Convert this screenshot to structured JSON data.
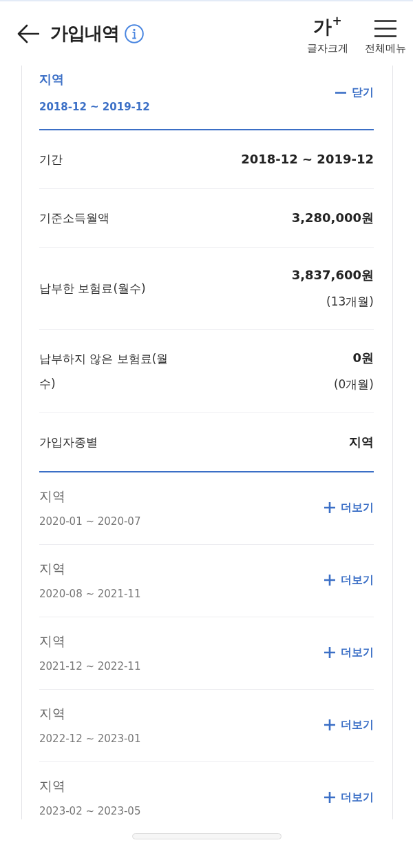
{
  "header": {
    "title": "가입내역",
    "font_size_button": {
      "glyph": "가$^{+}$",
      "label": "글자크게"
    },
    "menu_button": {
      "label": "전체메뉴"
    }
  },
  "periods": [
    {
      "category": "지역",
      "range": "2018-12 ~ 2019-12",
      "expanded": true,
      "toggle_label": "닫기",
      "details": [
        {
          "label": "기간",
          "value": "2018-12 ~ 2019-12"
        },
        {
          "label": "기준소득월액",
          "value": "3,280,000원"
        },
        {
          "label": "납부한 보험료(월수)",
          "value": "3,837,600원",
          "months": "(13개월)"
        },
        {
          "label": "납부하지 않은 보험료(월수)",
          "value": "0원",
          "months": "(0개월)"
        },
        {
          "label": "가입자종별",
          "value": "지역"
        }
      ]
    },
    {
      "category": "지역",
      "range": "2020-01 ~ 2020-07",
      "expanded": false,
      "toggle_label": "더보기"
    },
    {
      "category": "지역",
      "range": "2020-08 ~ 2021-11",
      "expanded": false,
      "toggle_label": "더보기"
    },
    {
      "category": "지역",
      "range": "2021-12 ~ 2022-11",
      "expanded": false,
      "toggle_label": "더보기"
    },
    {
      "category": "지역",
      "range": "2022-12 ~ 2023-01",
      "expanded": false,
      "toggle_label": "더보기"
    },
    {
      "category": "지역",
      "range": "2023-02 ~ 2023-05",
      "expanded": false,
      "toggle_label": "더보기"
    }
  ]
}
